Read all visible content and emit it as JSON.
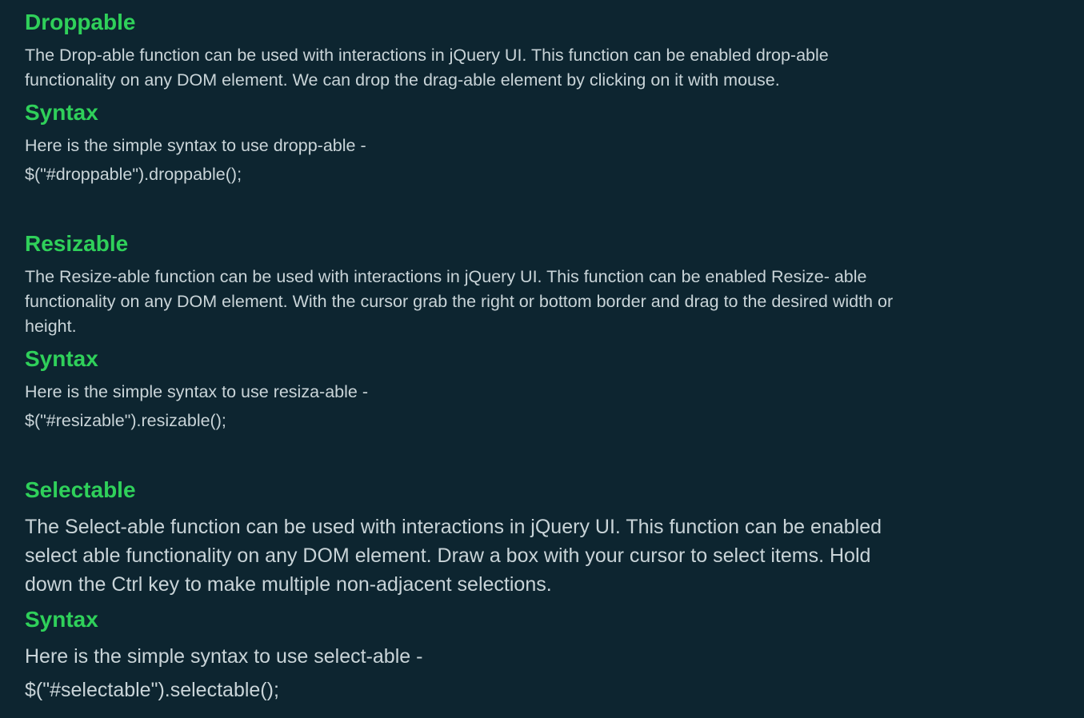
{
  "sections": [
    {
      "title": "Droppable",
      "description_lines": [
        "The Drop-able function can be used with interactions in jQuery UI.  This function can be enabled drop-able",
        "functionality on any DOM element.  We can drop the drag-able element by clicking on it with mouse."
      ],
      "syntax_heading": "Syntax",
      "syntax_intro": "Here is the simple syntax to use dropp-able -",
      "code": "$(\"#droppable\").droppable();"
    },
    {
      "title": "Resizable",
      "description_lines": [
        "The Resize-able function can be used with interactions in jQuery UI. This function can be enabled Resize- able",
        "functionality on any DOM element.  With the cursor grab the right or bottom border and drag to the desired width or",
        "height."
      ],
      "syntax_heading": "Syntax",
      "syntax_intro": "Here is the simple syntax to use resiza-able -",
      "code": "$(\"#resizable\").resizable();"
    },
    {
      "title": "Selectable",
      "description_lines": [
        "The Select-able function can be used with interactions in jQuery UI. This function can be enabled",
        "select able functionality on any DOM element. Draw a box with your cursor to select items. Hold",
        "down the Ctrl key to make multiple non-adjacent selections."
      ],
      "syntax_heading": "Syntax",
      "syntax_intro": "Here is the simple syntax to use select-able -",
      "code": "$(\"#selectable\").selectable();"
    }
  ],
  "colors": {
    "background": "#0d2530",
    "heading": "#2fd05a",
    "text": "#c9d4d8"
  }
}
